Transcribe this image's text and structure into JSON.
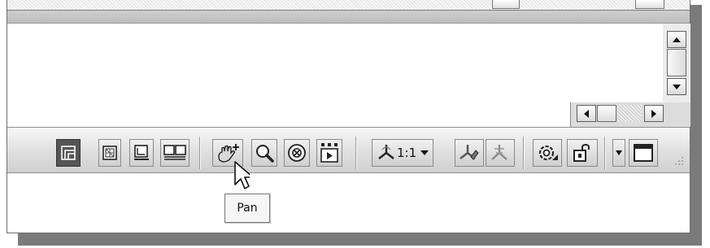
{
  "statusbar": {
    "scale_label": "1:1",
    "tooltip_text": "Pan"
  },
  "icons": [
    "model-icon",
    "grid-icon",
    "layout-icon",
    "dual-view-icon",
    "pan-icon",
    "zoom-icon",
    "steering-wheel-icon",
    "showmotion-icon",
    "annotation-scale-icon",
    "annotation-visibility-icon",
    "autoscale-icon",
    "workspace-switch-icon",
    "lock-icon",
    "clean-screen-icon",
    "scroll-up-icon",
    "scroll-down-icon",
    "scroll-left-icon",
    "scroll-right-icon",
    "resize-grip-icon",
    "mouse-cursor-icon"
  ],
  "colors": {
    "toolbar_bg": "#d8d8d8",
    "dark_button": "#555555",
    "shadow": "#7a7a7a"
  }
}
